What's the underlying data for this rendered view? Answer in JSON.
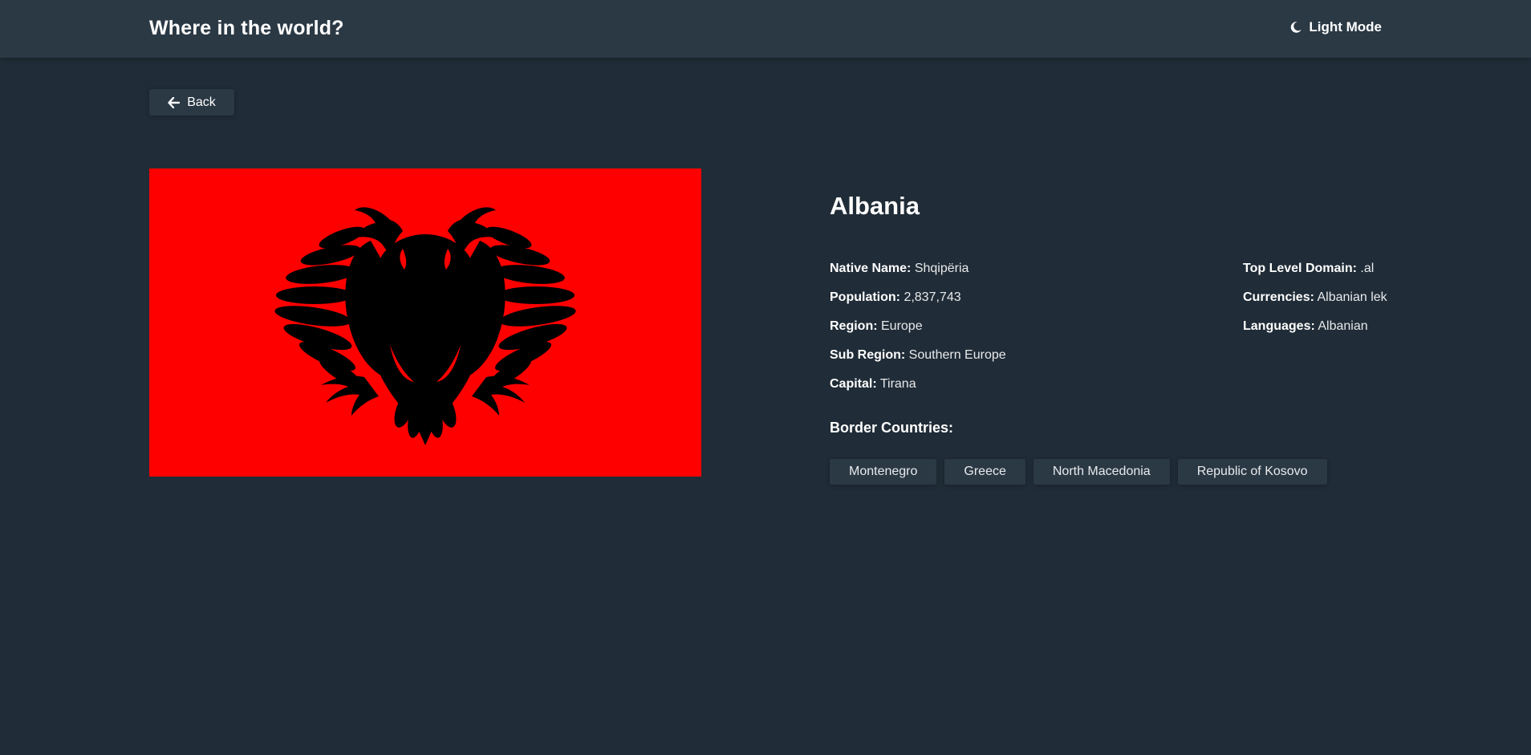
{
  "header": {
    "title": "Where in the world?",
    "theme_toggle_label": "Light Mode",
    "theme_icon": "moon-icon"
  },
  "back_button": {
    "label": "Back",
    "icon": "arrow-left-icon"
  },
  "flag": {
    "colors": {
      "field": "#ff0000",
      "eagle": "#000000"
    }
  },
  "country": {
    "name": "Albania",
    "details_left": [
      {
        "label": "Native Name:",
        "value": "Shqipëria"
      },
      {
        "label": "Population:",
        "value": "2,837,743"
      },
      {
        "label": "Region:",
        "value": "Europe"
      },
      {
        "label": "Sub Region:",
        "value": "Southern Europe"
      },
      {
        "label": "Capital:",
        "value": "Tirana"
      }
    ],
    "details_right": [
      {
        "label": "Top Level Domain:",
        "value": ".al"
      },
      {
        "label": "Currencies:",
        "value": "Albanian lek"
      },
      {
        "label": "Languages:",
        "value": "Albanian"
      }
    ],
    "border_label": "Border Countries:",
    "borders": [
      "Montenegro",
      "Greece",
      "North Macedonia",
      "Republic of Kosovo"
    ]
  },
  "colors": {
    "background": "#202c37",
    "element": "#2b3945",
    "text": "#ffffff"
  }
}
